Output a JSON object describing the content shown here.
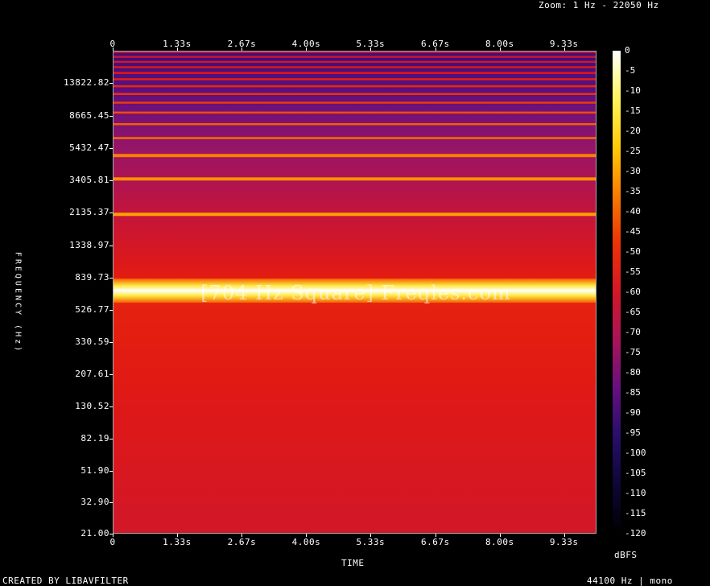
{
  "header": {
    "zoom": "Zoom: 1 Hz - 22050 Hz"
  },
  "footer": {
    "left": "CREATED BY LIBAVFILTER",
    "right": "44100 Hz | mono"
  },
  "watermark": "[704 Hz Square] Freqles.com",
  "chart_data": {
    "type": "heatmap",
    "title": "",
    "xlabel": "TIME",
    "ylabel": "FREQUENCY (Hz)",
    "x_ticks": [
      "0",
      "1.33s",
      "2.67s",
      "4.00s",
      "5.33s",
      "6.67s",
      "8.00s",
      "9.33s"
    ],
    "y_ticks": [
      "21.00",
      "32.90",
      "51.90",
      "82.19",
      "130.52",
      "207.61",
      "330.59",
      "526.77",
      "839.73",
      "1338.97",
      "2135.37",
      "3405.81",
      "5432.47",
      "8665.45",
      "13822.82"
    ],
    "y_scale": "log",
    "ylim": [
      21,
      22050
    ],
    "xlim_seconds": [
      0,
      10
    ],
    "colorbar": {
      "label": "dBFS",
      "ticks": [
        "0",
        "-5",
        "-10",
        "-15",
        "-20",
        "-25",
        "-30",
        "-35",
        "-40",
        "-45",
        "-50",
        "-55",
        "-60",
        "-65",
        "-70",
        "-75",
        "-80",
        "-85",
        "-90",
        "-95",
        "-100",
        "-105",
        "-110",
        "-115",
        "-120"
      ],
      "range": [
        -120,
        0
      ]
    },
    "harmonics_hz": [
      704,
      2112,
      3520,
      4928,
      6336,
      7744,
      9152,
      10560,
      11968,
      13376,
      14784,
      16192,
      17600,
      19008,
      20416,
      21824
    ]
  }
}
